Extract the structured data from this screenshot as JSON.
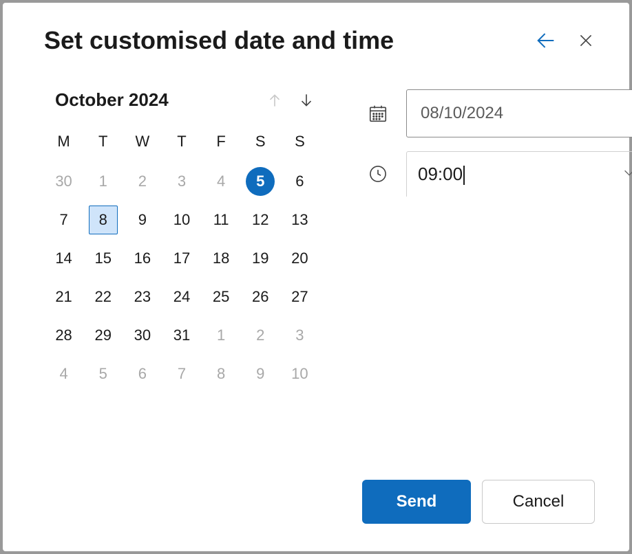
{
  "dialog": {
    "title": "Set customised date and time"
  },
  "calendar": {
    "month_label": "October 2024",
    "day_headers": [
      "M",
      "T",
      "W",
      "T",
      "F",
      "S",
      "S"
    ],
    "days": [
      {
        "n": "30",
        "state": "other"
      },
      {
        "n": "1",
        "state": "other"
      },
      {
        "n": "2",
        "state": "other"
      },
      {
        "n": "3",
        "state": "other"
      },
      {
        "n": "4",
        "state": "other"
      },
      {
        "n": "5",
        "state": "today"
      },
      {
        "n": "6",
        "state": ""
      },
      {
        "n": "7",
        "state": ""
      },
      {
        "n": "8",
        "state": "selected"
      },
      {
        "n": "9",
        "state": ""
      },
      {
        "n": "10",
        "state": ""
      },
      {
        "n": "11",
        "state": ""
      },
      {
        "n": "12",
        "state": ""
      },
      {
        "n": "13",
        "state": ""
      },
      {
        "n": "14",
        "state": ""
      },
      {
        "n": "15",
        "state": ""
      },
      {
        "n": "16",
        "state": ""
      },
      {
        "n": "17",
        "state": ""
      },
      {
        "n": "18",
        "state": ""
      },
      {
        "n": "19",
        "state": ""
      },
      {
        "n": "20",
        "state": ""
      },
      {
        "n": "21",
        "state": ""
      },
      {
        "n": "22",
        "state": ""
      },
      {
        "n": "23",
        "state": ""
      },
      {
        "n": "24",
        "state": ""
      },
      {
        "n": "25",
        "state": ""
      },
      {
        "n": "26",
        "state": ""
      },
      {
        "n": "27",
        "state": ""
      },
      {
        "n": "28",
        "state": ""
      },
      {
        "n": "29",
        "state": ""
      },
      {
        "n": "30",
        "state": ""
      },
      {
        "n": "31",
        "state": ""
      },
      {
        "n": "1",
        "state": "other"
      },
      {
        "n": "2",
        "state": "other"
      },
      {
        "n": "3",
        "state": "other"
      },
      {
        "n": "4",
        "state": "other"
      },
      {
        "n": "5",
        "state": "other"
      },
      {
        "n": "6",
        "state": "other"
      },
      {
        "n": "7",
        "state": "other"
      },
      {
        "n": "8",
        "state": "other"
      },
      {
        "n": "9",
        "state": "other"
      },
      {
        "n": "10",
        "state": "other"
      }
    ]
  },
  "fields": {
    "date_value": "08/10/2024",
    "time_value": "09:00"
  },
  "buttons": {
    "send": "Send",
    "cancel": "Cancel"
  }
}
